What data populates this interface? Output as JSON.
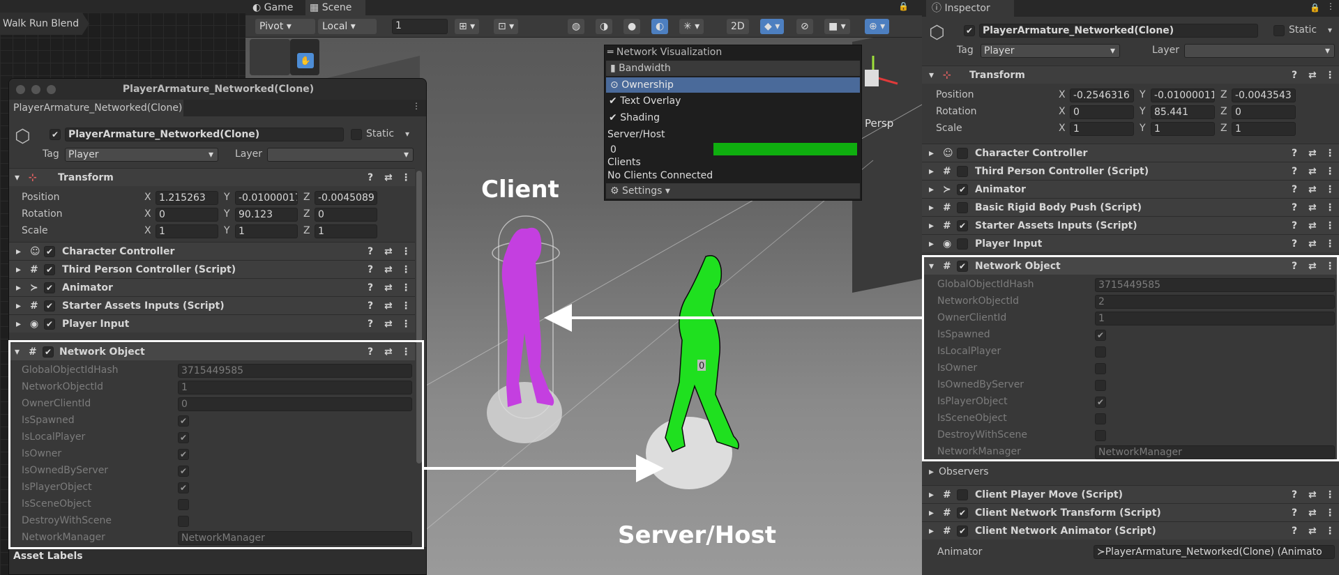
{
  "animator": {
    "breadcrumb": "Walk Run Blend"
  },
  "scene_tabs": {
    "game": "Game",
    "scene": "Scene"
  },
  "scene_toolbar": {
    "pivot": "Pivot",
    "local": "Local",
    "grid_value": "1",
    "mode_2d": "2D",
    "persp": "Persp"
  },
  "netvis": {
    "title": "Network Visualization",
    "bandwidth": "Bandwidth",
    "ownership": "Ownership",
    "text_overlay": "Text Overlay",
    "shading": "Shading",
    "server_host": "Server/Host",
    "server_count": "0",
    "clients": "Clients",
    "no_clients": "No Clients Connected",
    "settings": "Settings ▾"
  },
  "scene_labels": {
    "client": "Client",
    "server": "Server/Host",
    "overlay_num": "0"
  },
  "inspector": {
    "tab": "Inspector",
    "object_name": "PlayerArmature_Networked(Clone)",
    "static_label": "Static",
    "tag_label": "Tag",
    "tag_value": "Player",
    "layer_label": "Layer",
    "layer_value": "",
    "transform": "Transform",
    "position_label": "Position",
    "rotation_label": "Rotation",
    "scale_label": "Scale",
    "pos": [
      "-0.2546316",
      "-0.01000011",
      "-0.0043543"
    ],
    "rot": [
      "0",
      "85.441",
      "0"
    ],
    "scl": [
      "1",
      "1",
      "1"
    ],
    "axes": [
      "X",
      "Y",
      "Z"
    ],
    "components_top": [
      "Character Controller",
      "Third Person Controller (Script)",
      "Animator",
      "Basic Rigid Body Push (Script)",
      "Starter Assets Inputs (Script)",
      "Player Input"
    ],
    "network_object": "Network Object",
    "net_fields": [
      "GlobalObjectIdHash",
      "NetworkObjectId",
      "OwnerClientId",
      "IsSpawned",
      "IsLocalPlayer",
      "IsOwner",
      "IsOwnedByServer",
      "IsPlayerObject",
      "IsSceneObject",
      "DestroyWithScene",
      "NetworkManager"
    ],
    "net_values": {
      "hash": "3715449585",
      "id": "2",
      "owner": "1",
      "manager": "NetworkManager"
    },
    "net_checks": [
      true,
      false,
      false,
      false,
      true,
      false,
      false
    ],
    "observers": "Observers",
    "components_bottom": [
      "Client Player Move (Script)",
      "Client Network Transform (Script)",
      "Client Network Animator (Script)"
    ],
    "animator_label": "Animator",
    "animator_value": "≻PlayerArmature_Networked(Clone) (Animato"
  },
  "floating": {
    "title": "PlayerArmature_Networked(Clone)",
    "tab": "PlayerArmature_Networked(Clone)",
    "object_name": "PlayerArmature_Networked(Clone)",
    "static_label": "Static",
    "tag_label": "Tag",
    "tag_value": "Player",
    "layer_label": "Layer",
    "transform": "Transform",
    "position_label": "Position",
    "rotation_label": "Rotation",
    "scale_label": "Scale",
    "pos": [
      "1.215263",
      "-0.01000017",
      "-0.0045089"
    ],
    "rot": [
      "0",
      "90.123",
      "0"
    ],
    "scl": [
      "1",
      "1",
      "1"
    ],
    "axes": [
      "X",
      "Y",
      "Z"
    ],
    "components": [
      "Character Controller",
      "Third Person Controller (Script)",
      "Animator",
      "Starter Assets Inputs (Script)",
      "Player Input"
    ],
    "network_object": "Network Object",
    "net_fields": [
      "GlobalObjectIdHash",
      "NetworkObjectId",
      "OwnerClientId",
      "IsSpawned",
      "IsLocalPlayer",
      "IsOwner",
      "IsOwnedByServer",
      "IsPlayerObject",
      "IsSceneObject",
      "DestroyWithScene",
      "NetworkManager"
    ],
    "net_values": {
      "hash": "3715449585",
      "id": "1",
      "owner": "0",
      "manager": "NetworkManager"
    },
    "net_checks": [
      true,
      true,
      true,
      true,
      true,
      false,
      false
    ],
    "asset_labels": "Asset Labels"
  }
}
